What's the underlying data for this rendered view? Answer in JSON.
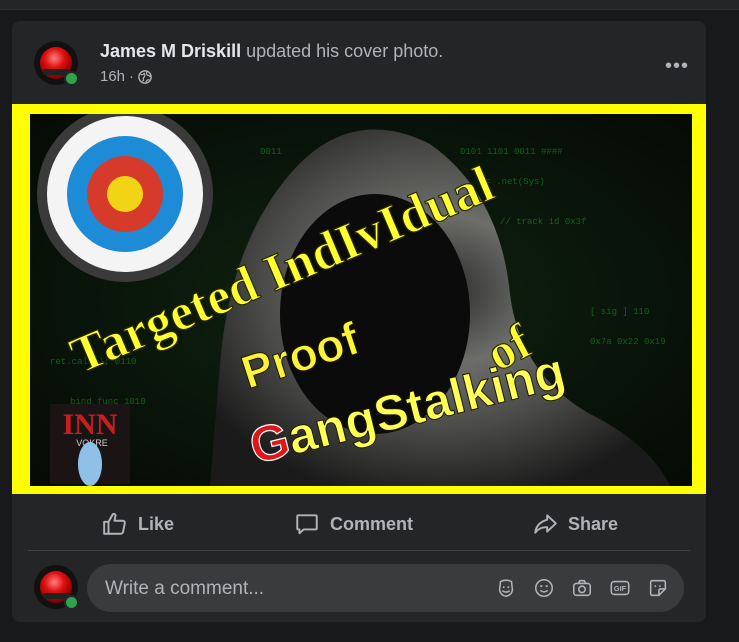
{
  "post": {
    "author": "James M Driskill",
    "action": "updated his cover photo.",
    "time": "16h",
    "separator": "·",
    "more": "•••"
  },
  "cover_image": {
    "line1": "Targeted IndIvIdual",
    "line2": "of",
    "line3": "Proof",
    "line4_g": "G",
    "line4_rest": "angStalking",
    "logo_text": "INN",
    "logo_sub": "VOKRE"
  },
  "actions": {
    "like": "Like",
    "comment": "Comment",
    "share": "Share"
  },
  "comment_input": {
    "placeholder": "Write a comment..."
  },
  "comment_icons": [
    "avatar-sticker-icon",
    "emoji-icon",
    "camera-icon",
    "gif-icon",
    "sticker-icon"
  ],
  "colors": {
    "background": "#18191a",
    "card": "#242526",
    "frame": "#ffff00",
    "online": "#31a24c",
    "text_primary": "#e4e6eb",
    "text_secondary": "#b0b3b8"
  }
}
